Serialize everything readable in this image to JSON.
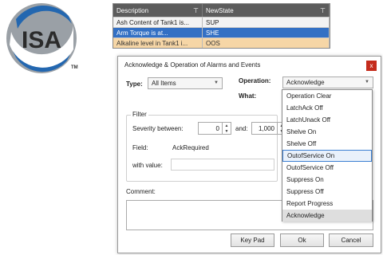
{
  "logo": {
    "text": "ISA",
    "trademark": "TM",
    "colors": {
      "blue": "#2367b0",
      "gray": "#9aa0a6"
    }
  },
  "grid": {
    "columns": [
      "Description",
      "NewState"
    ],
    "filter_icon": "filter-icon",
    "rows": [
      {
        "description": "Ash Content of Tank1 is...",
        "state": "SUP",
        "style": "plain"
      },
      {
        "description": "Arm Torque is at...",
        "state": "SHE",
        "style": "selected"
      },
      {
        "description": "Alkaline level in Tank1 i...",
        "state": "OOS",
        "style": "orange"
      }
    ]
  },
  "dialog": {
    "title": "Acknowledge & Operation of Alarms and Events",
    "close_label": "x",
    "type_label": "Type:",
    "type_value": "All Items",
    "operation_label": "Operation:",
    "operation_value": "Acknowledge",
    "what_label": "What:",
    "filter_legend": "Filter",
    "severity_label": "Severity between:",
    "severity_min": "0",
    "and_label": "and:",
    "severity_max": "1,000",
    "field_label": "Field:",
    "field_value": "AckRequired",
    "with_value_label": "with value:",
    "with_value": "",
    "comment_label": "Comment:",
    "comment_value": "",
    "buttons": {
      "keypad": "Key Pad",
      "ok": "Ok",
      "cancel": "Cancel"
    }
  },
  "operation_options": [
    "Operation Clear",
    "LatchAck Off",
    "LatchUnack Off",
    "Shelve On",
    "Shelve Off",
    "OutofService On",
    "OutofService Off",
    "Suppress On",
    "Suppress Off",
    "Report Progress",
    "Acknowledge"
  ],
  "operation_hover": "OutofService On",
  "operation_selected": "Acknowledge",
  "colors": {
    "selection_blue": "#3370c4",
    "alarm_orange": "#f6d6a6",
    "close_red": "#c42b1c"
  }
}
